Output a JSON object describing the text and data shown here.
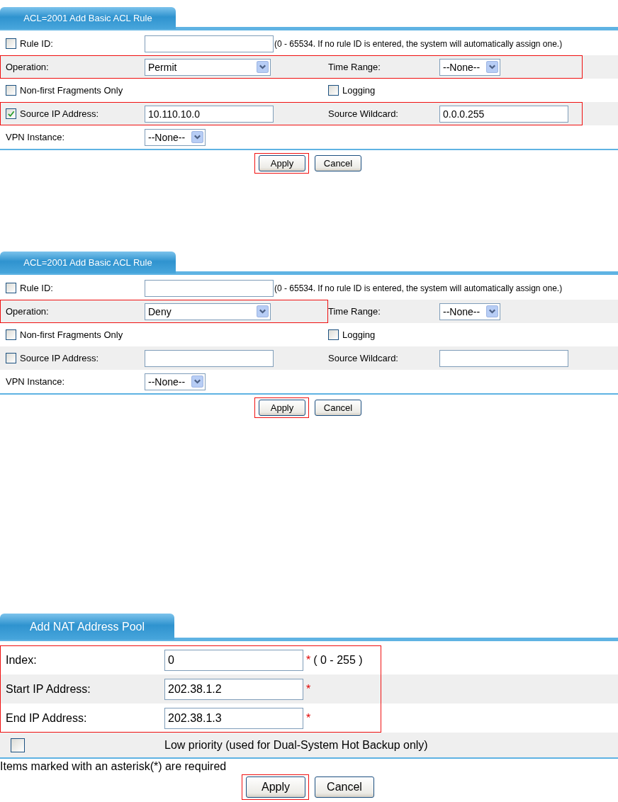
{
  "panels": [
    {
      "kind": "acl",
      "tab": "ACL=2001 Add Basic ACL Rule",
      "rows": [
        {
          "highlight": false,
          "cells": [
            {
              "kind": "checkbox",
              "checked": false,
              "label": "Rule ID:"
            },
            {
              "kind": "input"
            },
            {
              "kind": "hint",
              "label": "(0 - 65534. If no rule ID is entered, the system will automatically assign one.)"
            }
          ]
        },
        {
          "highlight": true,
          "cells": [
            {
              "kind": "label",
              "label": "Operation:",
              "in_frame": true
            },
            {
              "kind": "select",
              "value": "Permit",
              "wide": true,
              "in_frame": true
            },
            {
              "kind": "label",
              "label": "Time Range:",
              "in_frame": true
            },
            {
              "kind": "select",
              "value": "--None--",
              "wide": false,
              "in_frame": true
            }
          ]
        },
        {
          "highlight": false,
          "cells": [
            {
              "kind": "checkbox",
              "checked": false,
              "label": "Non-first Fragments Only"
            },
            {
              "kind": "empty"
            },
            {
              "kind": "checkbox",
              "checked": false,
              "label": "Logging"
            }
          ]
        },
        {
          "highlight": true,
          "cells": [
            {
              "kind": "checkbox",
              "checked": true,
              "label": "Source IP Address:",
              "in_frame": true
            },
            {
              "kind": "input",
              "value": "10.110.10.0",
              "in_frame": true
            },
            {
              "kind": "label",
              "label": "Source Wildcard:",
              "in_frame": true
            },
            {
              "kind": "input",
              "value": "0.0.0.255",
              "in_frame": true
            }
          ]
        },
        {
          "highlight": false,
          "cells": [
            {
              "kind": "label",
              "label": "VPN Instance:"
            },
            {
              "kind": "select",
              "value": "--None--",
              "wide": false
            }
          ]
        }
      ],
      "buttons": [
        {
          "label": "Apply",
          "highlight": true
        },
        {
          "label": "Cancel",
          "highlight": false
        }
      ]
    },
    {
      "kind": "acl",
      "tab": "ACL=2001 Add Basic ACL Rule",
      "rows": [
        {
          "highlight": false,
          "cells": [
            {
              "kind": "checkbox",
              "checked": false,
              "label": "Rule ID:"
            },
            {
              "kind": "input"
            },
            {
              "kind": "hint",
              "label": "(0 - 65534. If no rule ID is entered, the system will automatically assign one.)"
            }
          ]
        },
        {
          "highlight": true,
          "cells": [
            {
              "kind": "label",
              "label": "Operation:",
              "in_frame": true
            },
            {
              "kind": "select",
              "value": "Deny",
              "wide": true,
              "in_frame": true
            },
            {
              "kind": "label",
              "label": "Time Range:",
              "in_frame": false
            },
            {
              "kind": "select",
              "value": "--None--",
              "wide": false,
              "in_frame": false
            }
          ]
        },
        {
          "highlight": false,
          "cells": [
            {
              "kind": "checkbox",
              "checked": false,
              "label": "Non-first Fragments Only"
            },
            {
              "kind": "empty"
            },
            {
              "kind": "checkbox",
              "checked": false,
              "label": "Logging"
            }
          ]
        },
        {
          "highlight": false,
          "cells": [
            {
              "kind": "checkbox",
              "checked": false,
              "label": "Source IP Address:"
            },
            {
              "kind": "input"
            },
            {
              "kind": "label",
              "label": "Source Wildcard:"
            },
            {
              "kind": "input"
            }
          ]
        },
        {
          "highlight": false,
          "cells": [
            {
              "kind": "label",
              "label": "VPN Instance:"
            },
            {
              "kind": "select",
              "value": "--None--",
              "wide": false
            }
          ]
        }
      ],
      "buttons": [
        {
          "label": "Apply",
          "highlight": true
        },
        {
          "label": "Cancel",
          "highlight": false
        }
      ]
    },
    {
      "kind": "nat",
      "tab": "Add NAT Address Pool",
      "rows": [
        {
          "highlight": true,
          "cells": [
            {
              "kind": "label",
              "label": "Index:",
              "in_frame": true
            },
            {
              "kind": "input",
              "value": "0",
              "suffix": "*",
              "hint": "( 0 - 255 )",
              "in_frame": true
            }
          ]
        },
        {
          "highlight": true,
          "cells": [
            {
              "kind": "label",
              "label": "Start IP Address:",
              "in_frame": true
            },
            {
              "kind": "input",
              "value": "202.38.1.2",
              "suffix": "*",
              "in_frame": true
            }
          ]
        },
        {
          "highlight": true,
          "cells": [
            {
              "kind": "label",
              "label": "End IP Address:",
              "in_frame": true
            },
            {
              "kind": "input",
              "value": "202.38.1.3",
              "suffix": "*",
              "in_frame": true
            }
          ]
        },
        {
          "highlight": false,
          "cells": [
            {
              "kind": "checkbox",
              "checked": false
            },
            {
              "kind": "label",
              "label": "Low priority (used for Dual-System Hot Backup only)"
            }
          ]
        }
      ],
      "note": "Items marked with an asterisk(*) are required",
      "buttons": [
        {
          "label": "Apply",
          "highlight": true
        },
        {
          "label": "Cancel",
          "highlight": false
        }
      ]
    }
  ]
}
